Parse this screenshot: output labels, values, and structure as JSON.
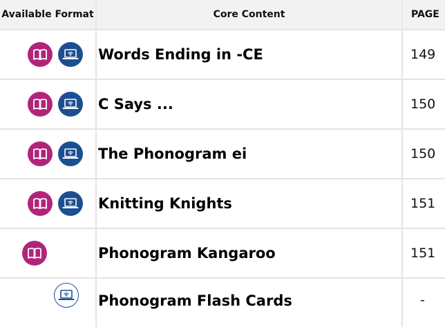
{
  "header": {
    "format": "Available Format",
    "content": "Core Content",
    "page": "PAGE"
  },
  "colors": {
    "book_icon": "#b0257a",
    "digital_icon": "#1c4f91"
  },
  "rows": [
    {
      "title": "Words Ending in -CE",
      "page": "149",
      "formats": [
        "book-icon",
        "laptop-icon"
      ]
    },
    {
      "title": "C Says ...",
      "page": "150",
      "formats": [
        "book-icon",
        "laptop-icon"
      ]
    },
    {
      "title": "The Phonogram ei",
      "page": "150",
      "formats": [
        "book-icon",
        "laptop-icon"
      ]
    },
    {
      "title": "Knitting Knights",
      "page": "151",
      "formats": [
        "book-icon",
        "laptop-icon"
      ]
    },
    {
      "title": "Phonogram Kangaroo",
      "page": "151",
      "formats": [
        "book-icon"
      ]
    },
    {
      "title": "Phonogram Flash Cards",
      "page": "-",
      "formats": [
        "laptop-outline-icon"
      ]
    }
  ]
}
